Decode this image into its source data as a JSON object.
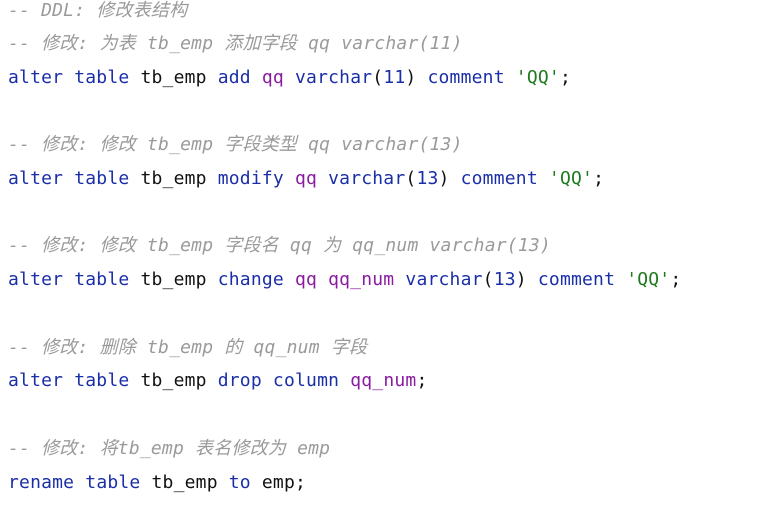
{
  "editor": {
    "lines": [
      {
        "type": "comment",
        "text": "-- DDL: 修改表结构"
      },
      {
        "type": "comment",
        "text": "-- 修改: 为表 tb_emp 添加字段 qq varchar(11)"
      },
      {
        "type": "code",
        "tokens": [
          {
            "cls": "kw",
            "text": "alter"
          },
          {
            "cls": "plain",
            "text": " "
          },
          {
            "cls": "kw",
            "text": "table"
          },
          {
            "cls": "plain",
            "text": " tb_emp "
          },
          {
            "cls": "kw",
            "text": "add"
          },
          {
            "cls": "plain",
            "text": " "
          },
          {
            "cls": "ident",
            "text": "qq"
          },
          {
            "cls": "plain",
            "text": " "
          },
          {
            "cls": "kw",
            "text": "varchar"
          },
          {
            "cls": "punct",
            "text": "("
          },
          {
            "cls": "num",
            "text": "11"
          },
          {
            "cls": "punct",
            "text": ") "
          },
          {
            "cls": "kw",
            "text": "comment"
          },
          {
            "cls": "plain",
            "text": " "
          },
          {
            "cls": "str",
            "text": "'QQ'"
          },
          {
            "cls": "punct",
            "text": ";"
          }
        ]
      },
      {
        "type": "comment",
        "text": "-- 修改: 修改 tb_emp 字段类型 qq varchar(13)"
      },
      {
        "type": "code",
        "tokens": [
          {
            "cls": "kw",
            "text": "alter"
          },
          {
            "cls": "plain",
            "text": " "
          },
          {
            "cls": "kw",
            "text": "table"
          },
          {
            "cls": "plain",
            "text": " tb_emp "
          },
          {
            "cls": "kw",
            "text": "modify"
          },
          {
            "cls": "plain",
            "text": " "
          },
          {
            "cls": "ident",
            "text": "qq"
          },
          {
            "cls": "plain",
            "text": " "
          },
          {
            "cls": "kw",
            "text": "varchar"
          },
          {
            "cls": "punct",
            "text": "("
          },
          {
            "cls": "num",
            "text": "13"
          },
          {
            "cls": "punct",
            "text": ") "
          },
          {
            "cls": "kw",
            "text": "comment"
          },
          {
            "cls": "plain",
            "text": " "
          },
          {
            "cls": "str",
            "text": "'QQ'"
          },
          {
            "cls": "punct",
            "text": ";"
          }
        ]
      },
      {
        "type": "comment",
        "text": "-- 修改: 修改 tb_emp 字段名 qq 为 qq_num varchar(13)"
      },
      {
        "type": "code",
        "tokens": [
          {
            "cls": "kw",
            "text": "alter"
          },
          {
            "cls": "plain",
            "text": " "
          },
          {
            "cls": "kw",
            "text": "table"
          },
          {
            "cls": "plain",
            "text": " tb_emp "
          },
          {
            "cls": "kw",
            "text": "change"
          },
          {
            "cls": "plain",
            "text": " "
          },
          {
            "cls": "ident",
            "text": "qq"
          },
          {
            "cls": "plain",
            "text": " "
          },
          {
            "cls": "ident",
            "text": "qq_num"
          },
          {
            "cls": "plain",
            "text": " "
          },
          {
            "cls": "kw",
            "text": "varchar"
          },
          {
            "cls": "punct",
            "text": "("
          },
          {
            "cls": "num",
            "text": "13"
          },
          {
            "cls": "punct",
            "text": ") "
          },
          {
            "cls": "kw",
            "text": "comment"
          },
          {
            "cls": "plain",
            "text": " "
          },
          {
            "cls": "str",
            "text": "'QQ'"
          },
          {
            "cls": "punct",
            "text": ";"
          }
        ]
      },
      {
        "type": "comment",
        "text": "-- 修改: 删除 tb_emp 的 qq_num 字段"
      },
      {
        "type": "code",
        "tokens": [
          {
            "cls": "kw",
            "text": "alter"
          },
          {
            "cls": "plain",
            "text": " "
          },
          {
            "cls": "kw",
            "text": "table"
          },
          {
            "cls": "plain",
            "text": " tb_emp "
          },
          {
            "cls": "kw",
            "text": "drop"
          },
          {
            "cls": "plain",
            "text": " "
          },
          {
            "cls": "kw",
            "text": "column"
          },
          {
            "cls": "plain",
            "text": " "
          },
          {
            "cls": "ident",
            "text": "qq_num"
          },
          {
            "cls": "punct",
            "text": ";"
          }
        ]
      },
      {
        "type": "comment",
        "text": "-- 修改: 将tb_emp 表名修改为 emp"
      },
      {
        "type": "code",
        "tokens": [
          {
            "cls": "kw",
            "text": "rename"
          },
          {
            "cls": "plain",
            "text": " "
          },
          {
            "cls": "kw",
            "text": "table"
          },
          {
            "cls": "plain",
            "text": " tb_emp "
          },
          {
            "cls": "kw",
            "text": "to"
          },
          {
            "cls": "plain",
            "text": " emp;"
          }
        ]
      }
    ]
  },
  "colors": {
    "background": "#ffffff",
    "comment": "#9a9a9a",
    "keyword": "#1a2ea8",
    "identifier": "#8a1aa0",
    "number": "#1a2ea8",
    "string": "#1f7a1f",
    "plain": "#111111"
  }
}
